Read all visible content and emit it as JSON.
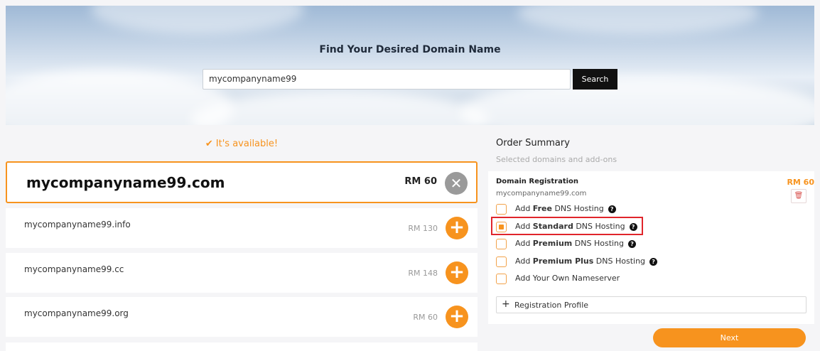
{
  "hero": {
    "title": "Find Your Desired Domain Name",
    "search_value": "mycompanyname99",
    "search_button": "Search"
  },
  "availability": {
    "check_icon": "✔",
    "text": "It's available!"
  },
  "primary_domain": {
    "name": "mycompanyname99.com",
    "price": "RM 60",
    "action_icon": "✕"
  },
  "alternatives": [
    {
      "name": "mycompanyname99.info",
      "price": "RM 130",
      "action_icon": "+"
    },
    {
      "name": "mycompanyname99.cc",
      "price": "RM 148",
      "action_icon": "+"
    },
    {
      "name": "mycompanyname99.org",
      "price": "RM 60",
      "action_icon": "+"
    }
  ],
  "summary": {
    "title": "Order Summary",
    "subtitle": "Selected domains and add-ons",
    "section_label": "Domain Registration",
    "domain": "mycompanyname99.com",
    "price": "RM 60",
    "trash_icon": "🗑",
    "options": [
      {
        "pre": "Add ",
        "bold": "Free",
        "post": " DNS Hosting",
        "help": "?",
        "checked": false
      },
      {
        "pre": "Add ",
        "bold": "Standard",
        "post": " DNS Hosting",
        "help": "?",
        "checked": true
      },
      {
        "pre": "Add ",
        "bold": "Premium",
        "post": " DNS Hosting",
        "help": "?",
        "checked": false
      },
      {
        "pre": "Add ",
        "bold": "Premium Plus",
        "post": " DNS Hosting",
        "help": "?",
        "checked": false
      },
      {
        "pre": "Add Your Own Nameserver",
        "bold": "",
        "post": "",
        "help": "",
        "checked": false
      }
    ],
    "profile_plus": "+",
    "profile_label": "Registration Profile"
  },
  "next_button": "Next",
  "colors": {
    "accent": "#f7931e",
    "highlight": "#e0252b",
    "remove": "#9a9a9a"
  }
}
